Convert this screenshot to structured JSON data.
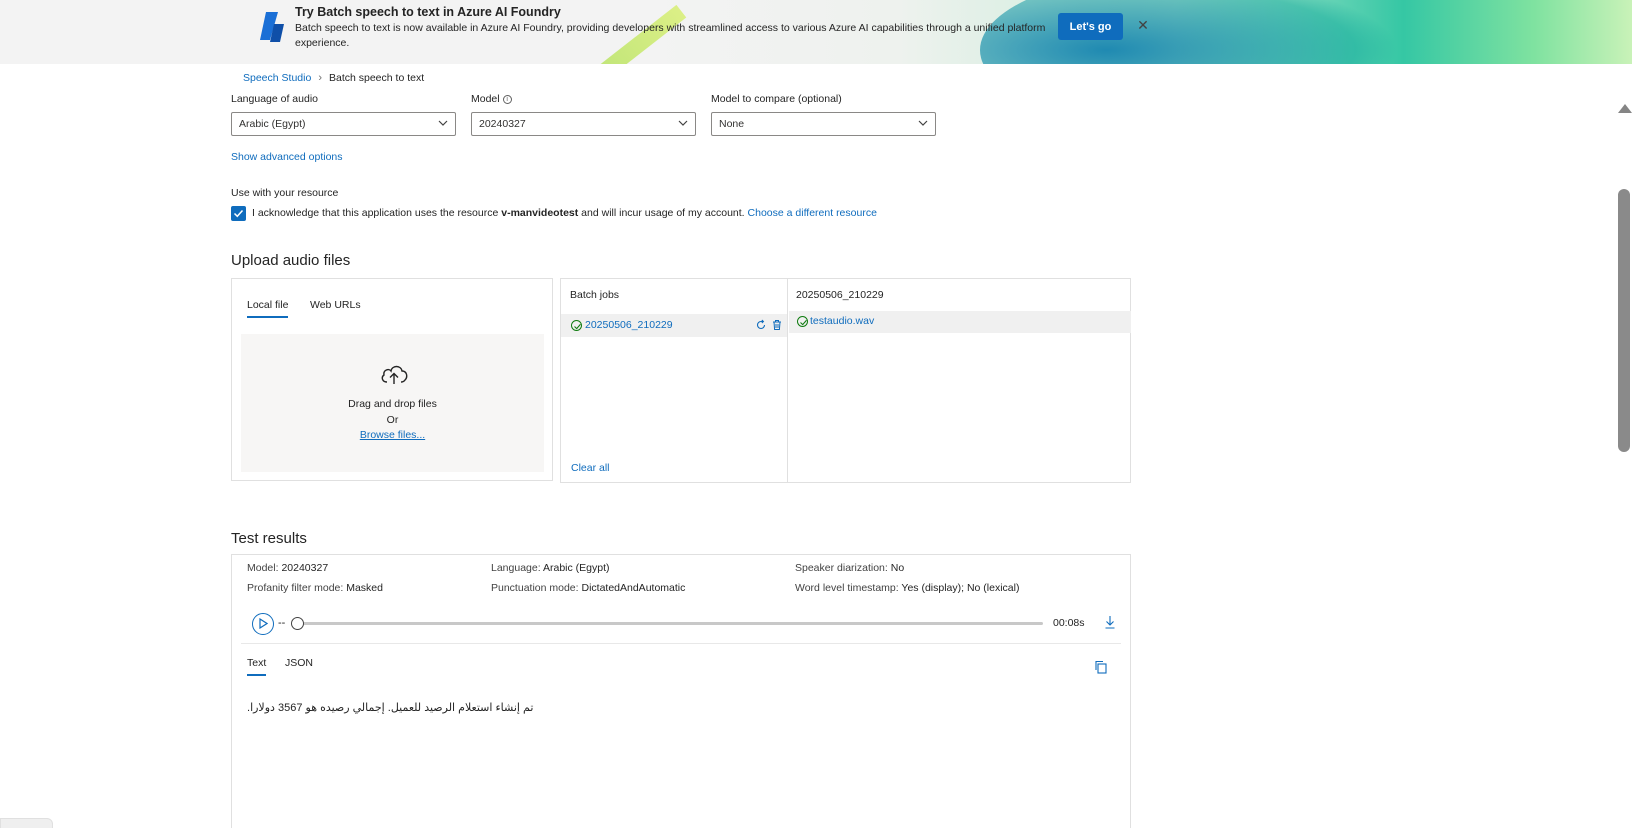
{
  "banner": {
    "title": "Try Batch speech to text in Azure AI Foundry",
    "description": "Batch speech to text is now available in Azure AI Foundry, providing developers with streamlined access to various Azure AI capabilities through a unified platform experience.",
    "cta_label": "Let's go",
    "close_glyph": "✕"
  },
  "breadcrumb": {
    "root": "Speech Studio",
    "separator": "›",
    "current": "Batch speech to text"
  },
  "config": {
    "language_label": "Language of audio",
    "language_value": "Arabic (Egypt)",
    "model_label": "Model",
    "model_value": "20240327",
    "compare_label": "Model to compare (optional)",
    "compare_value": "None",
    "advanced_link": "Show advanced options"
  },
  "resource": {
    "heading": "Use with your resource",
    "ack_prefix": "I acknowledge that this application uses the resource ",
    "resource_name": "v-manvideotest",
    "ack_suffix": " and will incur usage of my account. ",
    "change_link": "Choose a different resource",
    "checked": true
  },
  "upload": {
    "title": "Upload audio files",
    "tabs": [
      "Local file",
      "Web URLs"
    ],
    "drag_text": "Drag and drop files",
    "or_text": "Or",
    "browse_link": "Browse files..."
  },
  "jobs": {
    "header": "Batch jobs",
    "items": [
      {
        "name": "20250506_210229",
        "status": "succeeded"
      }
    ],
    "clear_all": "Clear all",
    "selected_job": "20250506_210229",
    "files": [
      {
        "name": "testaudio.wav",
        "status": "succeeded"
      }
    ]
  },
  "results": {
    "title": "Test results",
    "meta": {
      "model_k": "Model: ",
      "model_v": "20240327",
      "language_k": "Language: ",
      "language_v": "Arabic (Egypt)",
      "diarization_k": "Speaker diarization: ",
      "diarization_v": "No",
      "profanity_k": "Profanity filter mode: ",
      "profanity_v": "Masked",
      "punctuation_k": "Punctuation mode: ",
      "punctuation_v": "DictatedAndAutomatic",
      "timestamp_k": "Word level timestamp: ",
      "timestamp_v": "Yes (display); No (lexical)"
    },
    "player": {
      "position": "--",
      "duration": "00:08s",
      "progress": 0
    },
    "tabs": [
      "Text",
      "JSON"
    ],
    "transcript": ".تم إنشاء استعلام الرصيد للعميل. إجمالي رصيده هو 3567 دولارا"
  },
  "colors": {
    "accent": "#0f6cbd",
    "success": "#107c10"
  }
}
